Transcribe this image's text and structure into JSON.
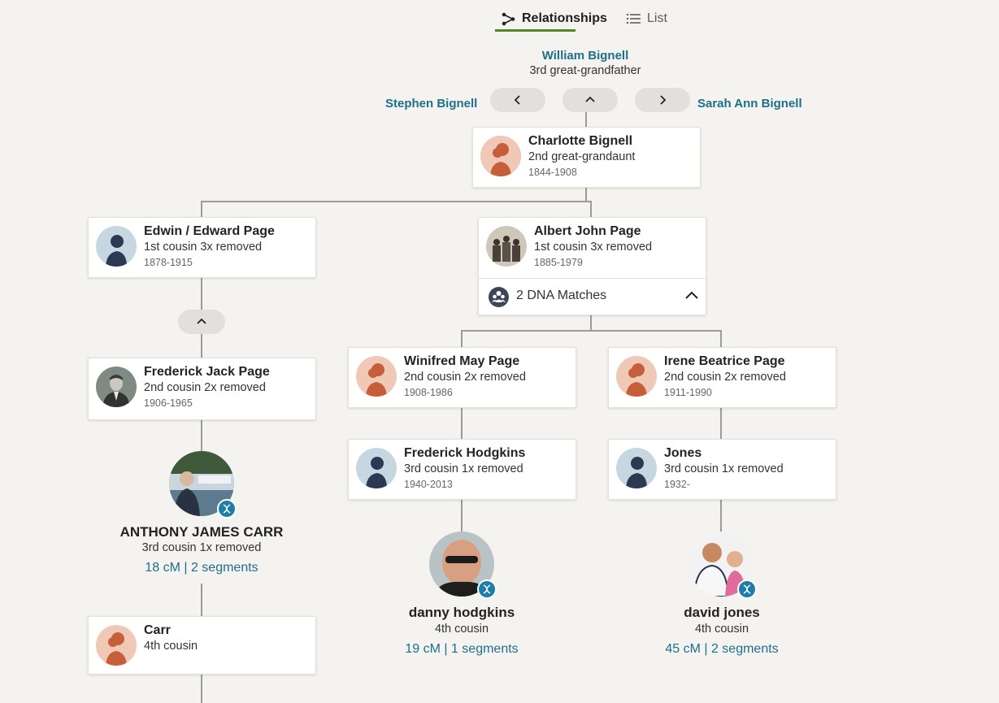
{
  "tabs": {
    "relationships": "Relationships",
    "list": "List"
  },
  "ancestor": {
    "name": "William Bignell",
    "relationship": "3rd great-grandfather"
  },
  "siblings": {
    "left": "Stephen Bignell",
    "right": "Sarah Ann Bignell"
  },
  "people": {
    "charlotte": {
      "name": "Charlotte Bignell",
      "relationship": "2nd great-grandaunt",
      "years": "1844-1908"
    },
    "edwin": {
      "name": "Edwin / Edward Page",
      "relationship": "1st cousin 3x removed",
      "years": "1878-1915"
    },
    "albert": {
      "name": "Albert John Page",
      "relationship": "1st cousin 3x removed",
      "years": "1885-1979",
      "dna": "2 DNA Matches"
    },
    "frederick_jack": {
      "name": "Frederick Jack Page",
      "relationship": "2nd cousin 2x removed",
      "years": "1906-1965"
    },
    "winifred": {
      "name": "Winifred May Page",
      "relationship": "2nd cousin 2x removed",
      "years": "1908-1986"
    },
    "irene": {
      "name": "Irene Beatrice Page",
      "relationship": "2nd cousin 2x removed",
      "years": "1911-1990"
    },
    "frederick_hodgkins": {
      "name": "Frederick Hodgkins",
      "relationship": "3rd cousin 1x removed",
      "years": "1940-2013"
    },
    "jones": {
      "name": "Jones",
      "relationship": "3rd cousin 1x removed",
      "years": "1932-"
    },
    "carr": {
      "name": "Carr",
      "relationship": "4th cousin"
    }
  },
  "matches": {
    "anthony": {
      "name": "ANTHONY JAMES CARR",
      "relationship": "3rd cousin 1x removed",
      "cm": "18 cM | 2 segments"
    },
    "danny": {
      "name": "danny hodgkins",
      "relationship": "4th cousin",
      "cm": "19 cM | 1 segments"
    },
    "david": {
      "name": "david jones",
      "relationship": "4th cousin",
      "cm": "45 cM | 2 segments"
    }
  },
  "colors": {
    "link": "#1d6f8c",
    "tab_underline": "#4b8a1d",
    "dna_badge": "#1d7fa8",
    "background": "#f5f3f0"
  },
  "icons": {
    "relationships": "tree-branch-icon",
    "list": "list-icon",
    "nav_left": "chevron-left-icon",
    "nav_up": "chevron-up-icon",
    "nav_right": "chevron-right-icon",
    "dna": "people-group-icon",
    "dna_badge": "dna-helix-icon"
  }
}
